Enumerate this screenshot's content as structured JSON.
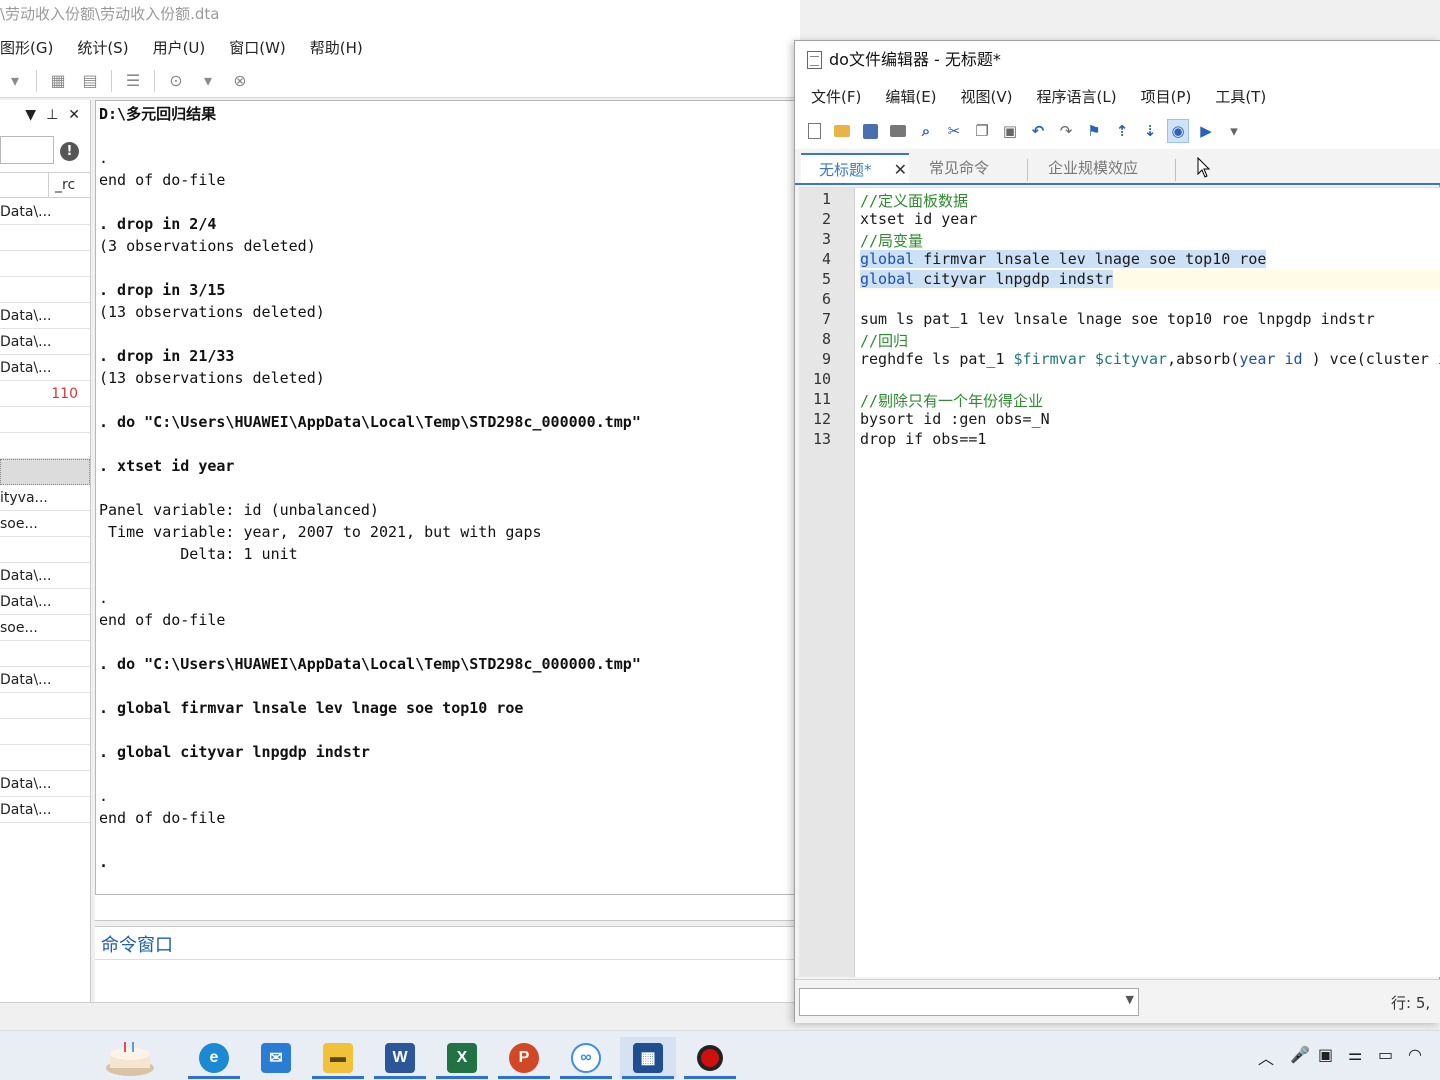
{
  "main_window": {
    "title": "\\劳动收入份额\\劳动收入份额.dta",
    "menu": [
      "图形(G)",
      "统计(S)",
      "用户(U)",
      "窗口(W)",
      "帮助(H)"
    ]
  },
  "variables_panel": {
    "column_header": "_rc",
    "rows": [
      {
        "text": "Data\\...",
        "rc": ""
      },
      {
        "text": "",
        "rc": ""
      },
      {
        "text": "",
        "rc": ""
      },
      {
        "text": "",
        "rc": ""
      },
      {
        "text": "Data\\...",
        "rc": ""
      },
      {
        "text": "Data\\...",
        "rc": ""
      },
      {
        "text": "Data\\...",
        "rc": ""
      },
      {
        "text": "",
        "rc": "110"
      },
      {
        "text": "",
        "rc": ""
      },
      {
        "text": "",
        "rc": ""
      },
      {
        "text": "",
        "rc": ""
      },
      {
        "text": "ityva...",
        "rc": ""
      },
      {
        "text": " soe...",
        "rc": ""
      },
      {
        "text": "",
        "rc": ""
      },
      {
        "text": "Data\\...",
        "rc": ""
      },
      {
        "text": "Data\\...",
        "rc": ""
      },
      {
        "text": " soe...",
        "rc": ""
      },
      {
        "text": "",
        "rc": ""
      },
      {
        "text": "Data\\...",
        "rc": ""
      },
      {
        "text": "",
        "rc": ""
      },
      {
        "text": "",
        "rc": ""
      },
      {
        "text": "",
        "rc": ""
      },
      {
        "text": "Data\\...",
        "rc": ""
      },
      {
        "text": "Data\\...",
        "rc": ""
      }
    ]
  },
  "results": {
    "header": "D:\\多元回归结果",
    "lines": [
      {
        "text": "",
        "bold": false
      },
      {
        "text": ".",
        "bold": false
      },
      {
        "text": "end of do-file",
        "bold": false
      },
      {
        "text": "",
        "bold": false
      },
      {
        "text": ". drop in 2/4",
        "bold": true
      },
      {
        "text": "(3 observations deleted)",
        "bold": false
      },
      {
        "text": "",
        "bold": false
      },
      {
        "text": ". drop in 3/15",
        "bold": true
      },
      {
        "text": "(13 observations deleted)",
        "bold": false
      },
      {
        "text": "",
        "bold": false
      },
      {
        "text": ". drop in 21/33",
        "bold": true
      },
      {
        "text": "(13 observations deleted)",
        "bold": false
      },
      {
        "text": "",
        "bold": false
      },
      {
        "text": ". do \"C:\\Users\\HUAWEI\\AppData\\Local\\Temp\\STD298c_000000.tmp\"",
        "bold": true
      },
      {
        "text": "",
        "bold": false
      },
      {
        "text": ". xtset id year",
        "bold": true
      },
      {
        "text": "",
        "bold": false
      },
      {
        "text": "Panel variable: id (unbalanced)",
        "bold": false
      },
      {
        "text": " Time variable: year, 2007 to 2021, but with gaps",
        "bold": false
      },
      {
        "text": "         Delta: 1 unit",
        "bold": false
      },
      {
        "text": "",
        "bold": false
      },
      {
        "text": ".",
        "bold": false
      },
      {
        "text": "end of do-file",
        "bold": false
      },
      {
        "text": "",
        "bold": false
      },
      {
        "text": ". do \"C:\\Users\\HUAWEI\\AppData\\Local\\Temp\\STD298c_000000.tmp\"",
        "bold": true
      },
      {
        "text": "",
        "bold": false
      },
      {
        "text": ". global firmvar lnsale lev lnage soe top10 roe",
        "bold": true
      },
      {
        "text": "",
        "bold": false
      },
      {
        "text": ". global cityvar lnpgdp indstr",
        "bold": true
      },
      {
        "text": "",
        "bold": false
      },
      {
        "text": ".",
        "bold": false
      },
      {
        "text": "end of do-file",
        "bold": false
      },
      {
        "text": "",
        "bold": false
      },
      {
        "text": ".",
        "bold": true
      }
    ]
  },
  "command_window": {
    "title": "命令窗口"
  },
  "editor": {
    "title": "do文件编辑器 - 无标题*",
    "menu": [
      "文件(F)",
      "编辑(E)",
      "视图(V)",
      "程序语言(L)",
      "项目(P)",
      "工具(T)"
    ],
    "tabs": [
      "无标题*",
      "常见命令",
      "企业规模效应"
    ],
    "tab_close": "✕",
    "line_numbers": [
      "1",
      "2",
      "3",
      "4",
      "5",
      "6",
      "7",
      "8",
      "9",
      "10",
      "11",
      "12",
      "13"
    ],
    "code": [
      "//定义面板数据",
      "xtset id year",
      "//局变量",
      "global firmvar lnsale lev lnage soe top10 roe",
      "global cityvar lnpgdp indstr",
      "",
      "sum ls pat_1 lev lnsale lnage soe top10 roe lnpgdp indstr",
      "//回归",
      "reghdfe ls pat_1 $firmvar $cityvar,absorb(year id ) vce(cluster i",
      "",
      "//剔除只有一个年份得企业",
      "bysort id :gen obs=_N",
      "drop if obs==1"
    ],
    "status_position": "行: 5,"
  },
  "taskbar": {
    "apps": [
      "cake-app",
      "edge",
      "mail",
      "file-explorer",
      "word",
      "excel",
      "powerpoint",
      "baidu-netdisk",
      "stata",
      "recorder"
    ],
    "colors": {
      "edge": "#1b8ad3",
      "mail": "#2b7cd3",
      "explorer": "#f2c13a",
      "word": "#2b579a",
      "excel": "#217346",
      "powerpoint": "#d24726",
      "stata": "#1f4f8f",
      "record": "#d01010"
    }
  }
}
